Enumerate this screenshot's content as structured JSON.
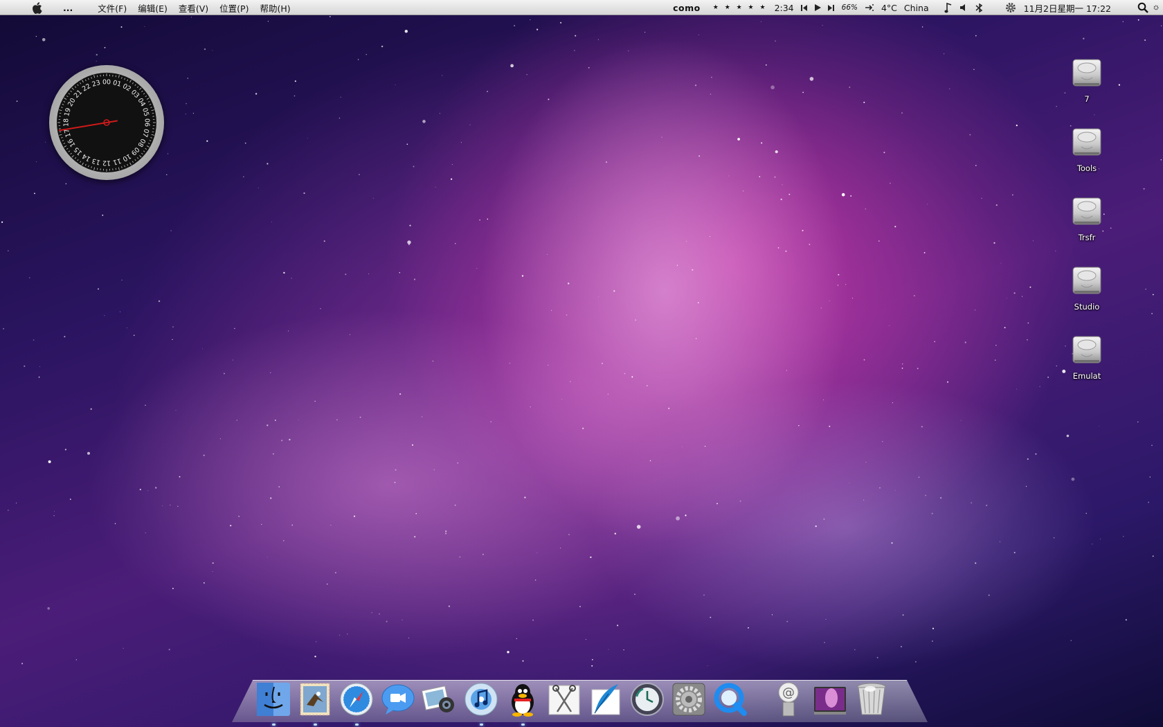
{
  "menubar": {
    "apple_icon": "apple-icon",
    "overflow": "...",
    "menus": [
      "文件(F)",
      "编辑(E)",
      "查看(V)",
      "位置(P)",
      "帮助(H)"
    ],
    "status": {
      "song": "como",
      "rating": "★ ★ ★ ★ ★",
      "time_elapsed": "2:34",
      "battery": "66%",
      "temperature": "4°C",
      "location": "China",
      "datetime": "11月2日星期一 17:22"
    }
  },
  "desktop": {
    "drives": [
      {
        "label": "7"
      },
      {
        "label": "Tools"
      },
      {
        "label": "Trsfr"
      },
      {
        "label": "Studio"
      },
      {
        "label": "Emulat"
      }
    ]
  },
  "clock_widget": {
    "hours_labels": [
      "00",
      "01",
      "02",
      "03",
      "04",
      "05",
      "06",
      "07",
      "08",
      "09",
      "10",
      "11",
      "12",
      "13",
      "14",
      "15",
      "16",
      "17",
      "18",
      "19",
      "20",
      "21",
      "22",
      "23"
    ],
    "hour_value": 17.37
  },
  "dock": {
    "items": [
      {
        "name": "finder-icon",
        "running": true
      },
      {
        "name": "mail-icon",
        "running": true
      },
      {
        "name": "safari-icon",
        "running": true
      },
      {
        "name": "ichat-icon",
        "running": false
      },
      {
        "name": "iphoto-icon",
        "running": false
      },
      {
        "name": "itunes-icon",
        "running": true
      },
      {
        "name": "qq-icon",
        "running": true
      },
      {
        "name": "scissors-icon",
        "running": false
      },
      {
        "name": "quill-icon",
        "running": false
      },
      {
        "name": "time-machine-icon",
        "running": false
      },
      {
        "name": "system-preferences-icon",
        "running": false
      },
      {
        "name": "quicktime-icon",
        "running": false
      },
      {
        "name": "email-stack-icon",
        "running": false
      },
      {
        "name": "desktop-folder-icon",
        "running": false
      },
      {
        "name": "trash-icon",
        "running": false
      }
    ]
  },
  "colors": {
    "accent_pink": "#d63caf",
    "clock_hand": "#d11a1a"
  }
}
